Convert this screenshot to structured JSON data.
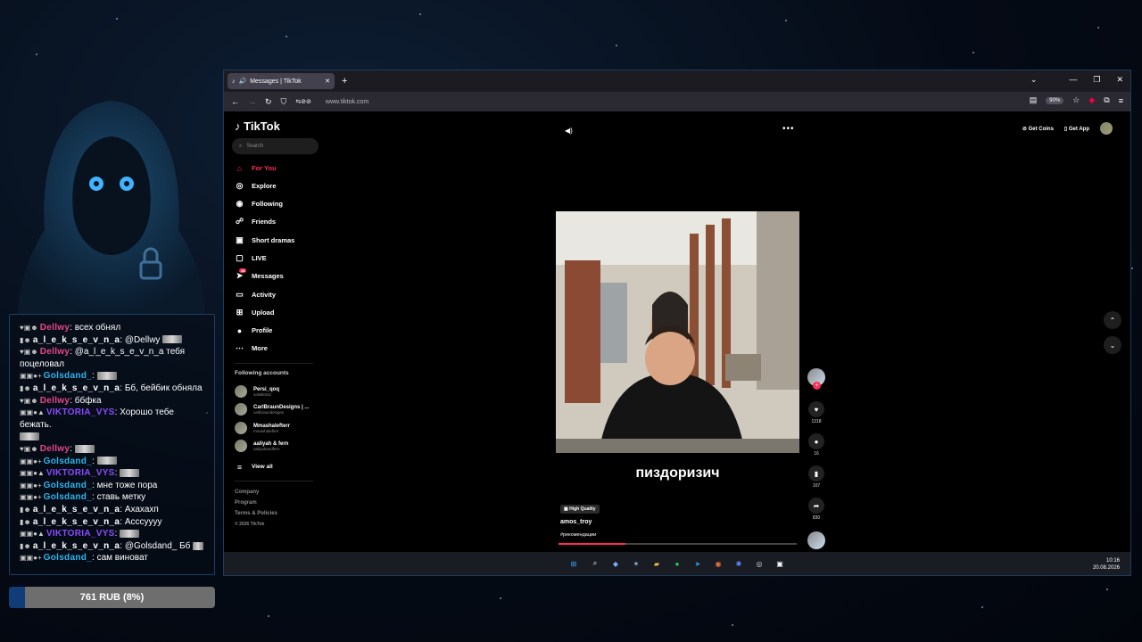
{
  "chat": {
    "messages": [
      {
        "user": "Dellwy",
        "color": "#e8458a",
        "text": "всех обнял"
      },
      {
        "user": "a_l_e_k_s_e_v_n_a",
        "color": "#ffffff",
        "text": "@Dellwy"
      },
      {
        "user": "Dellwy",
        "color": "#e8458a",
        "text": "@a_l_e_k_s_e_v_n_a тебя поцеловал"
      },
      {
        "user": "Golsdand_",
        "color": "#2bb6ef",
        "text": ""
      },
      {
        "user": "a_l_e_k_s_e_v_n_a",
        "color": "#ffffff",
        "text": "Бб, бейбик обняла"
      },
      {
        "user": "Dellwy",
        "color": "#e8458a",
        "text": "ббфка"
      },
      {
        "user": "VIKTORIA_VYS",
        "color": "#8a4bff",
        "text": "Хорошо тебе бежать."
      },
      {
        "user": "Dellwy",
        "color": "#e8458a",
        "text": ""
      },
      {
        "user": "Golsdand_",
        "color": "#2bb6ef",
        "text": ""
      },
      {
        "user": "VIKTORIA_VYS",
        "color": "#8a4bff",
        "text": ""
      },
      {
        "user": "Golsdand_",
        "color": "#2bb6ef",
        "text": "мне тоже пора"
      },
      {
        "user": "Golsdand_",
        "color": "#2bb6ef",
        "text": "ставь метку"
      },
      {
        "user": "a_l_e_k_s_e_v_n_a",
        "color": "#ffffff",
        "text": "Ахахахп"
      },
      {
        "user": "a_l_e_k_s_e_v_n_a",
        "color": "#ffffff",
        "text": "Асссуууу"
      },
      {
        "user": "VIKTORIA_VYS",
        "color": "#8a4bff",
        "text": ""
      },
      {
        "user": "a_l_e_k_s_e_v_n_a",
        "color": "#ffffff",
        "text": "@Golsdand_ Бб"
      },
      {
        "user": "Golsdand_",
        "color": "#2bb6ef",
        "text": "сам виноват"
      }
    ]
  },
  "goal": {
    "text": "761 RUB (8%)",
    "fraction": 0.08
  },
  "browser": {
    "tab_title": "Messages | TikTok",
    "url": "www.tiktok.com",
    "zoom": "90%"
  },
  "tiktok": {
    "logo": "TikTok",
    "search_placeholder": "Search",
    "nav": [
      "For You",
      "Explore",
      "Following",
      "Friends",
      "Short dramas",
      "LIVE",
      "Messages",
      "Activity",
      "Upload",
      "Profile",
      "More"
    ],
    "messages_badge": "18",
    "following_title": "Following accounts",
    "accounts": [
      {
        "name": "Persi_qoq",
        "handle": "salstik042"
      },
      {
        "name": "CarlBraunDesigns | ...",
        "handle": "carlbraundesigns"
      },
      {
        "name": "Mmashalefterr",
        "handle": "mmashalefterr"
      },
      {
        "name": "aaliyah & fern",
        "handle": "aaliyahandfern"
      }
    ],
    "view_all": "View all",
    "footer": [
      "Company",
      "Program",
      "Terms & Policies",
      "© 2026 TikTok"
    ],
    "get_coins": "Get Coins",
    "get_app": "Get App",
    "caption": "пиздоризич",
    "quality": "High Quality",
    "author": "amos_troy",
    "hashtag": "#рекомендации",
    "progress": 0.28,
    "likes": "1318",
    "comments": "16",
    "saves": "107",
    "shares": "830"
  },
  "clock": {
    "time": "10:16",
    "date": "20.08.2026"
  },
  "colors": {
    "accent": "#fe2c55",
    "frame": "#1e3b5c",
    "chat_border": "#1f3f63"
  }
}
